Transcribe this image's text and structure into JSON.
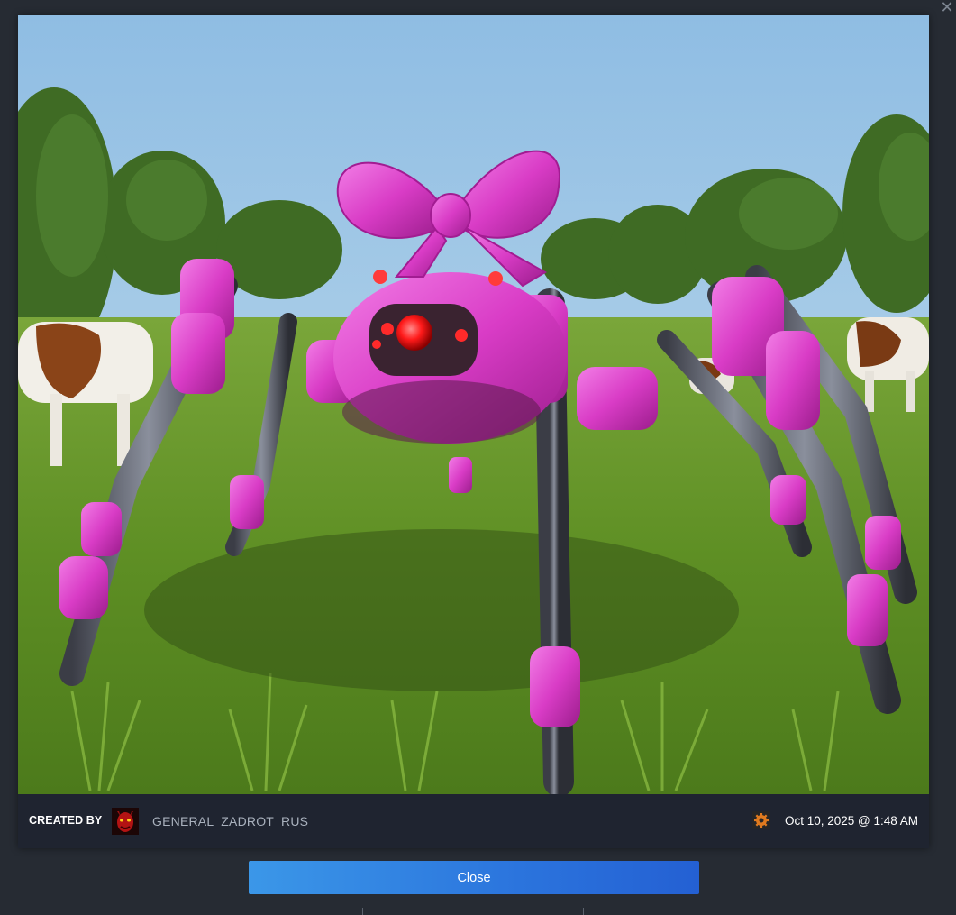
{
  "window": {
    "close_glyph": "✕"
  },
  "artwork": {
    "alt": "Pink mechanical spider with a bow in a grassy field with cows"
  },
  "infobar": {
    "created_by_label": "CREATED BY",
    "author_name": "GENERAL_ZADROT_RUS",
    "date": "Oct 10, 2025 @ 1:48 AM",
    "avatar_icon": "demon-avatar-icon",
    "game_icon": "gear-game-icon"
  },
  "actions": {
    "close_label": "Close"
  },
  "colors": {
    "accent": "#2f86e4",
    "background": "#262b33",
    "infobar": "#1f2430",
    "bow_pink": "#e03ccc"
  }
}
